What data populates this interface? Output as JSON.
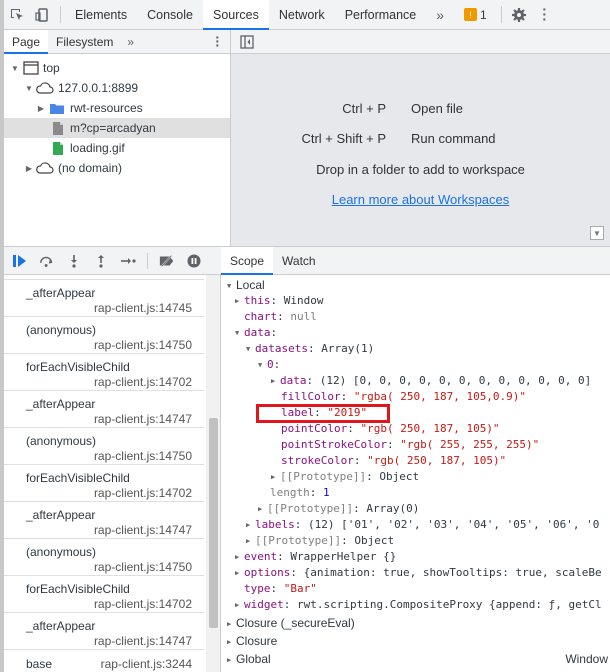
{
  "toolbar": {
    "tabs": [
      "Elements",
      "Console",
      "Sources",
      "Network",
      "Performance"
    ],
    "active_tab": "Sources",
    "more": "»",
    "issues_count": "1"
  },
  "navigator": {
    "tabs": [
      "Page",
      "Filesystem"
    ],
    "more": "»",
    "tree": {
      "top": "top",
      "host": "127.0.0.1:8899",
      "folder": "rwt-resources",
      "file1": "m?cp=arcadyan",
      "file2": "loading.gif",
      "nodomain": "(no domain)"
    }
  },
  "editor": {
    "shortcut1_key": "Ctrl + P",
    "shortcut1_label": "Open file",
    "shortcut2_key": "Ctrl + Shift + P",
    "shortcut2_label": "Run command",
    "drop_text": "Drop in a folder to add to workspace",
    "learn_link": "Learn more about Workspaces"
  },
  "callstack": [
    {
      "fn": "_afterAppear",
      "loc": "rap-client.js:14745"
    },
    {
      "fn": "(anonymous)",
      "loc": "rap-client.js:14750"
    },
    {
      "fn": "forEachVisibleChild",
      "loc": "rap-client.js:14702"
    },
    {
      "fn": "_afterAppear",
      "loc": "rap-client.js:14747"
    },
    {
      "fn": "(anonymous)",
      "loc": "rap-client.js:14750"
    },
    {
      "fn": "forEachVisibleChild",
      "loc": "rap-client.js:14702"
    },
    {
      "fn": "_afterAppear",
      "loc": "rap-client.js:14747"
    },
    {
      "fn": "(anonymous)",
      "loc": "rap-client.js:14750"
    },
    {
      "fn": "forEachVisibleChild",
      "loc": "rap-client.js:14702"
    },
    {
      "fn": "_afterAppear",
      "loc": "rap-client.js:14747"
    },
    {
      "fn": "base",
      "loc": "rap-client.js:3244"
    }
  ],
  "scope": {
    "tabs": [
      "Scope",
      "Watch"
    ],
    "local": "Local",
    "this_key": "this",
    "this_val": "Window",
    "chart_key": "chart",
    "chart_val": "null",
    "data_key": "data",
    "datasets_key": "datasets",
    "datasets_val": "Array(1)",
    "idx0": "0",
    "data_inner_key": "data",
    "data_inner_val": "(12) [0, 0, 0, 0, 0, 0, 0, 0, 0, 0, 0, 0]",
    "fillColor_key": "fillColor",
    "fillColor_val": "\"rgba( 250, 187, 105,0.9)\"",
    "label_key": "label",
    "label_val": "\"2019\"",
    "pointColor_key": "pointColor",
    "pointColor_val": "\"rgb( 250, 187, 105)\"",
    "pointStrokeColor_key": "pointStrokeColor",
    "pointStrokeColor_val": "\"rgb( 255, 255, 255)\"",
    "strokeColor_key": "strokeColor",
    "strokeColor_val": "\"rgb( 250, 187, 105)\"",
    "proto_key": "[[Prototype]]",
    "proto_obj": "Object",
    "length_key": "length",
    "length_val": "1",
    "proto_arr": "Array(0)",
    "labels_key": "labels",
    "labels_val": "(12) ['01', '02', '03', '04', '05', '06', '0",
    "event_key": "event",
    "event_val": "WrapperHelper {}",
    "options_key": "options",
    "options_val": "{animation: true, showTooltips: true, scaleBe",
    "type_key": "type",
    "type_val": "\"Bar\"",
    "widget_key": "widget",
    "widget_val": "rwt.scripting.CompositeProxy {append: ƒ, getCl",
    "closure1": "Closure (_secureEval)",
    "closure2": "Closure",
    "global": "Global",
    "global_val": "Window"
  },
  "colors": {
    "accent": "#1a73e8",
    "highlight": "#e0161c",
    "warning": "#f29900"
  }
}
